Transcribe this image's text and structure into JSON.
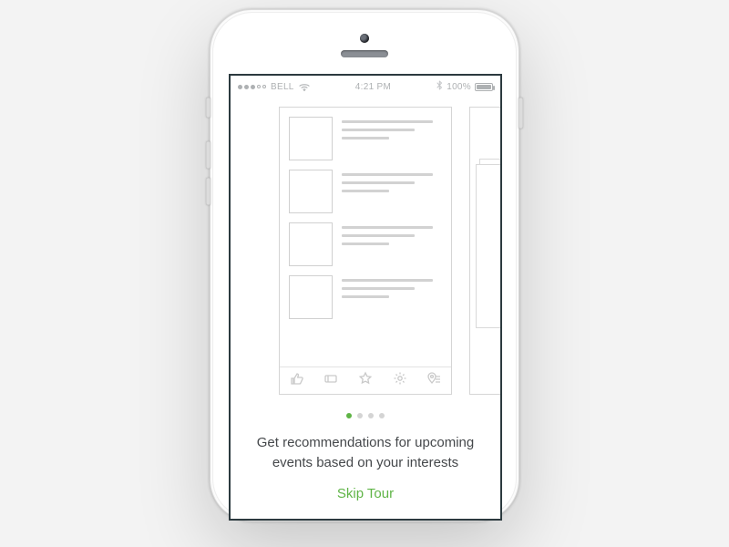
{
  "status_bar": {
    "carrier": "BELL",
    "time": "4:21 PM",
    "battery_pct": "100%"
  },
  "onboarding": {
    "caption": "Get recommendations for upcoming events based on your interests",
    "skip_label": "Skip Tour",
    "page_count": 4,
    "active_page_index": 0
  },
  "icons": {
    "tab1": "thumbs-up-icon",
    "tab2": "ticket-icon",
    "tab3": "star-icon",
    "tab4": "gear-icon",
    "tab5": "map-pin-icon"
  },
  "colors": {
    "accent": "#5fb446"
  }
}
